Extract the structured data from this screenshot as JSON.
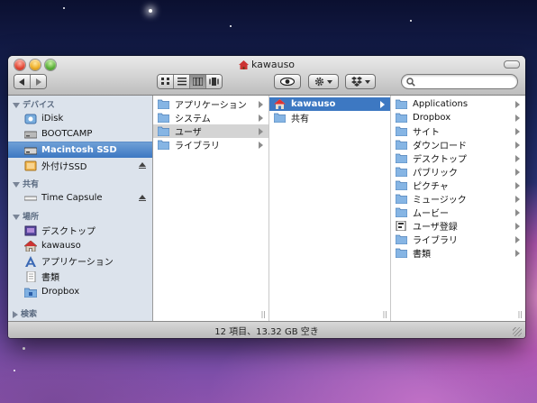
{
  "window": {
    "title": "kawauso"
  },
  "toolbar": {
    "search_placeholder": "",
    "view_modes": [
      "icon",
      "list",
      "column",
      "coverflow"
    ],
    "active_view": "column"
  },
  "sidebar": {
    "sections": [
      {
        "label": "デバイス",
        "items": [
          {
            "label": "iDisk",
            "icon": "idisk-icon"
          },
          {
            "label": "BOOTCAMP",
            "icon": "hard-drive-icon"
          },
          {
            "label": "Macintosh SSD",
            "icon": "hard-drive-icon",
            "selected": true
          },
          {
            "label": "外付けSSD",
            "icon": "external-drive-icon",
            "eject": true
          }
        ]
      },
      {
        "label": "共有",
        "items": [
          {
            "label": "Time Capsule",
            "icon": "time-capsule-icon",
            "eject": true
          }
        ]
      },
      {
        "label": "場所",
        "items": [
          {
            "label": "デスクトップ",
            "icon": "desktop-folder-icon"
          },
          {
            "label": "kawauso",
            "icon": "home-icon"
          },
          {
            "label": "アプリケーション",
            "icon": "applications-icon"
          },
          {
            "label": "書類",
            "icon": "documents-icon"
          },
          {
            "label": "Dropbox",
            "icon": "dropbox-folder-icon"
          }
        ]
      },
      {
        "label": "検索",
        "items": []
      }
    ]
  },
  "columns": [
    [
      {
        "label": "アプリケーション",
        "arrow": true
      },
      {
        "label": "システム",
        "arrow": true
      },
      {
        "label": "ユーザ",
        "arrow": true,
        "state": "gray"
      },
      {
        "label": "ライブラリ",
        "arrow": true
      }
    ],
    [
      {
        "label": "kawauso",
        "arrow": true,
        "state": "blue",
        "icon": "home-icon"
      },
      {
        "label": "共有",
        "arrow": true
      }
    ],
    [
      {
        "label": "Applications",
        "arrow": true
      },
      {
        "label": "Dropbox",
        "arrow": true
      },
      {
        "label": "サイト",
        "arrow": true
      },
      {
        "label": "ダウンロード",
        "arrow": true
      },
      {
        "label": "デスクトップ",
        "arrow": true
      },
      {
        "label": "パブリック",
        "arrow": true
      },
      {
        "label": "ピクチャ",
        "arrow": true
      },
      {
        "label": "ミュージック",
        "arrow": true
      },
      {
        "label": "ムービー",
        "arrow": true
      },
      {
        "label": "ユーザ登録",
        "arrow": true,
        "icon": "app-icon"
      },
      {
        "label": "ライブラリ",
        "arrow": true
      },
      {
        "label": "書類",
        "arrow": true
      }
    ]
  ],
  "status": {
    "text": "12 項目、13.32 GB 空き"
  },
  "colors": {
    "selection_blue": "#3d78c2",
    "sidebar_bg": "#dce3ec"
  }
}
